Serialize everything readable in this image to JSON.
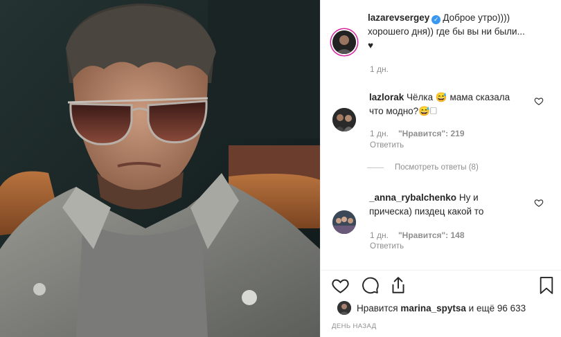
{
  "caption": {
    "username": "lazarevsergey",
    "text_line1": "Доброе утро))))",
    "text_line2": "хорошего дня)) где бы вы ни были...",
    "text_line3": "♥",
    "time": "1 дн."
  },
  "comments": [
    {
      "username": "lazlorak",
      "text_line1": "Чёлка 😅 мама сказала",
      "text_line2": "что модно?😅🗆",
      "time": "1 дн.",
      "likes": "\"Нравится\": 219",
      "reply": "Ответить"
    },
    {
      "username": "_anna_rybalchenko",
      "text_line1": "Ну и",
      "text_line2": "прическа) пиздец какой то",
      "time": "1 дн.",
      "likes": "\"Нравится\": 148",
      "reply": "Ответить"
    }
  ],
  "view_replies": "Посмотреть ответы (8)",
  "likes_summary": {
    "prefix": "Нравится",
    "user": "marina_spytsa",
    "suffix": "и ещё 96 633"
  },
  "date_label": "ДЕНЬ НАЗАД",
  "icons": [
    "heart-icon",
    "comment-icon",
    "share-icon",
    "bookmark-icon",
    "verified-badge-icon"
  ],
  "colors": {
    "verified": "#3897f0",
    "muted": "#8e8e8e",
    "text": "#262626"
  }
}
